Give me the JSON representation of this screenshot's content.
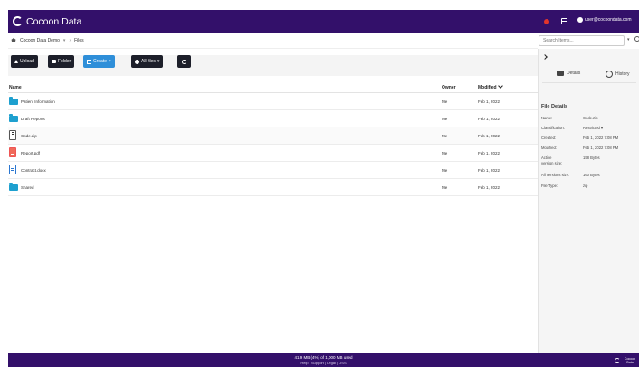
{
  "app": {
    "title": "Cocoon Data",
    "user_email": "user@cocoondata.com"
  },
  "breadcrumb": {
    "workspace": "Cocoon Data Demo",
    "current": "Files"
  },
  "search": {
    "placeholder": "Search Items..."
  },
  "toolbar": {
    "upload": "Upload",
    "folder": "Folder",
    "create": "Create",
    "all_files": "All files"
  },
  "table": {
    "headers": {
      "name": "Name",
      "owner": "Owner",
      "modified": "Modified"
    },
    "rows": [
      {
        "name": "Patient Information",
        "owner": "Me",
        "modified": "Feb 1, 2022",
        "type": "folder-icon"
      },
      {
        "name": "Draft Reports",
        "owner": "Me",
        "modified": "Feb 1, 2022",
        "type": "folder-icon"
      },
      {
        "name": "Code.zip",
        "owner": "Me",
        "modified": "Feb 1, 2022",
        "type": "zip-file-icon"
      },
      {
        "name": "Report.pdf",
        "owner": "Me",
        "modified": "Feb 1, 2022",
        "type": "pdf-file-icon"
      },
      {
        "name": "Contract.docx",
        "owner": "Me",
        "modified": "Feb 1, 2022",
        "type": "word-file-icon"
      },
      {
        "name": "Shared",
        "owner": "Me",
        "modified": "Feb 1, 2022",
        "type": "folder-icon"
      }
    ]
  },
  "panel": {
    "tabs": {
      "details": "Details",
      "history": "History"
    },
    "title": "File Details",
    "fields": [
      {
        "label": "Name:",
        "value": "Code.zip"
      },
      {
        "label": "Classification:",
        "value": "Restricted ▾"
      },
      {
        "label": "Created:",
        "value": "Feb 1, 2022 7:08 PM"
      },
      {
        "label": "Modified:",
        "value": "Feb 1, 2022 7:08 PM"
      },
      {
        "label": "Active version size:",
        "value": "158 Bytes"
      },
      {
        "label": "All versions size:",
        "value": "160 Bytes"
      },
      {
        "label": "File Type:",
        "value": "zip"
      }
    ]
  },
  "footer": {
    "usage": "41.9 MB (4%) of 1,000 MB used",
    "links": "Help | Support | Legal | OSS",
    "logo_text": "Cocoon Data"
  },
  "colors": {
    "brand": "#33106a",
    "accent": "#2f8fd9",
    "folder": "#1ea0cf"
  }
}
